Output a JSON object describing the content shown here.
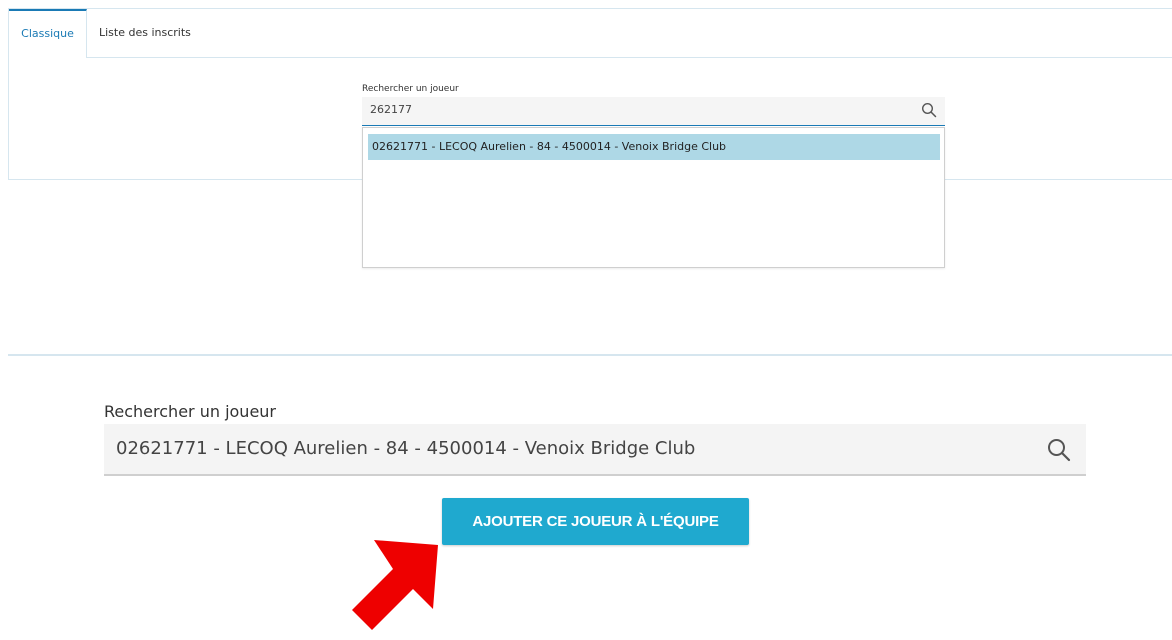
{
  "tabs": [
    {
      "label": "Classique",
      "active": true
    },
    {
      "label": "Liste des inscrits",
      "active": false
    }
  ],
  "small_search": {
    "label": "Rechercher un joueur",
    "value": "262177",
    "icon": "search-icon"
  },
  "dropdown": {
    "options": [
      "02621771 - LECOQ Aurelien - 84 - 4500014 - Venoix Bridge Club"
    ]
  },
  "big_search": {
    "label": "Rechercher un joueur",
    "value": "02621771 - LECOQ Aurelien - 84 - 4500014 - Venoix Bridge Club",
    "icon": "search-icon"
  },
  "add_button": {
    "label": "AJOUTER CE JOUEUR À L'ÉQUIPE"
  },
  "colors": {
    "accent": "#1a7ab5",
    "button": "#1fa9cf",
    "highlight": "#aed8e6",
    "arrow": "#ee0000"
  },
  "annotation": {
    "icon": "red-arrow-icon"
  }
}
